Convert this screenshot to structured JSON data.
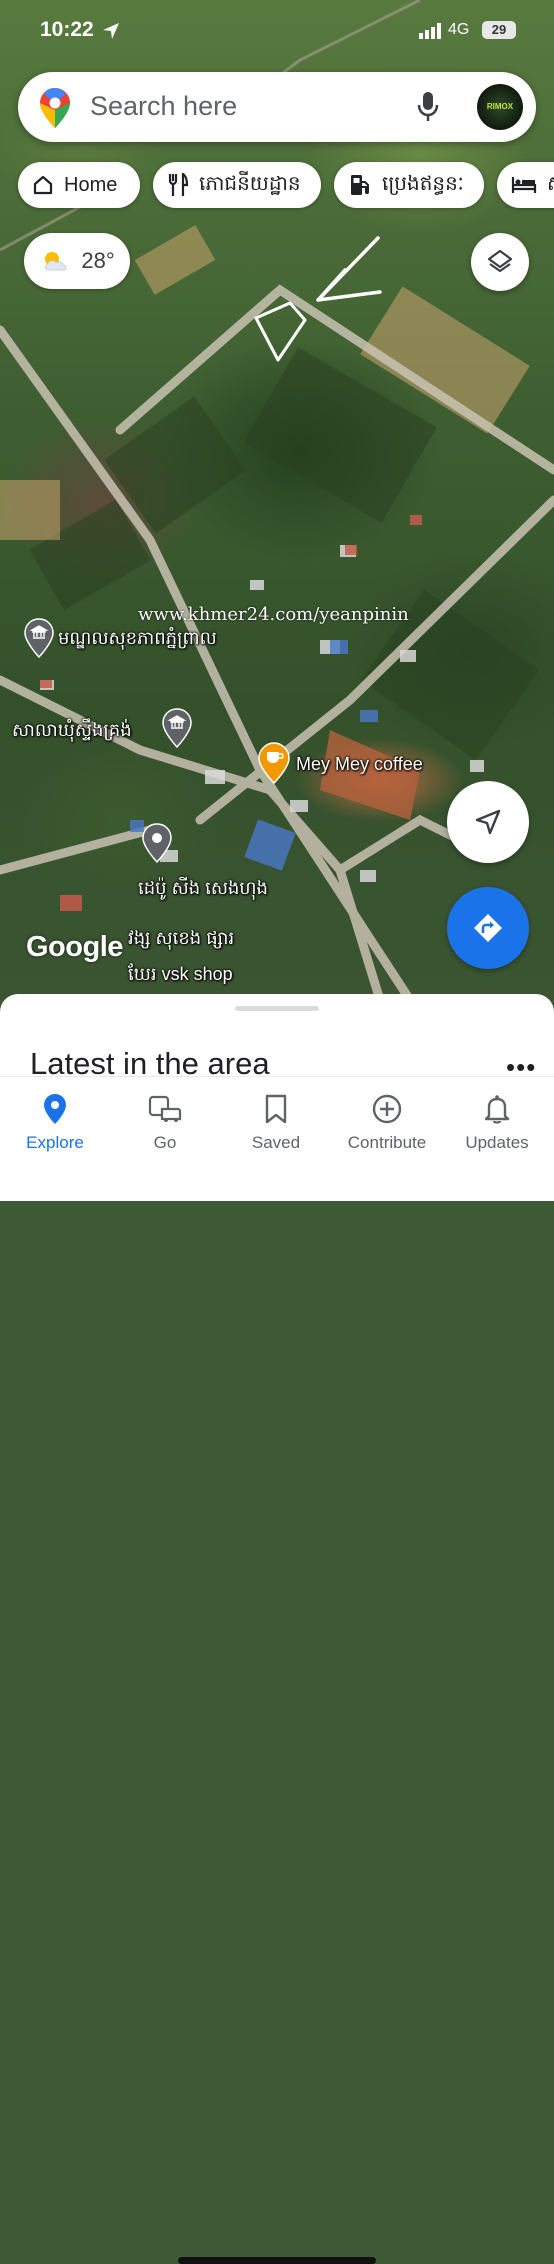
{
  "status_bar": {
    "time": "10:22",
    "network": "4G",
    "battery": "29"
  },
  "search": {
    "placeholder": "Search here",
    "avatar_text": "RIMOX"
  },
  "chips": [
    {
      "label": "Home",
      "icon": "home-icon"
    },
    {
      "label": "ភោជនីយដ្ឋាន",
      "icon": "restaurant-icon"
    },
    {
      "label": "ប្រេងឥន្ធនៈ",
      "icon": "gas-station-icon"
    },
    {
      "label": "ស",
      "icon": "hotel-icon"
    }
  ],
  "weather": {
    "temperature": "28°",
    "icon": "partly-cloudy-icon"
  },
  "map_labels": {
    "watermark": "www.khmer24.com/yeanpinin",
    "health_center": "មណ្ឌលសុខភាពភ្នំព្រាល",
    "commune_hall": "សាលាឃុំស្ទឹងគ្រង់",
    "cafe": "Mey Mey coffee",
    "depot_line1": "ដេប៉ូ សីង សេងហុង",
    "depot_line2": "វង្ស សុខេង ផ្សារ",
    "depot_line3": "ឃែរ vsk shop",
    "google_logo": "Google"
  },
  "sheet": {
    "title": "Latest in the area",
    "more": "•••"
  },
  "nav": [
    {
      "label": "Explore",
      "icon": "explore-pin-icon",
      "active": true
    },
    {
      "label": "Go",
      "icon": "commute-icon",
      "active": false
    },
    {
      "label": "Saved",
      "icon": "bookmark-icon",
      "active": false
    },
    {
      "label": "Contribute",
      "icon": "add-circle-icon",
      "active": false
    },
    {
      "label": "Updates",
      "icon": "bell-icon",
      "active": false
    }
  ],
  "colors": {
    "accent": "#1a73e8",
    "cafe_pin": "#f29900",
    "poi_pin": "#5f6368"
  }
}
